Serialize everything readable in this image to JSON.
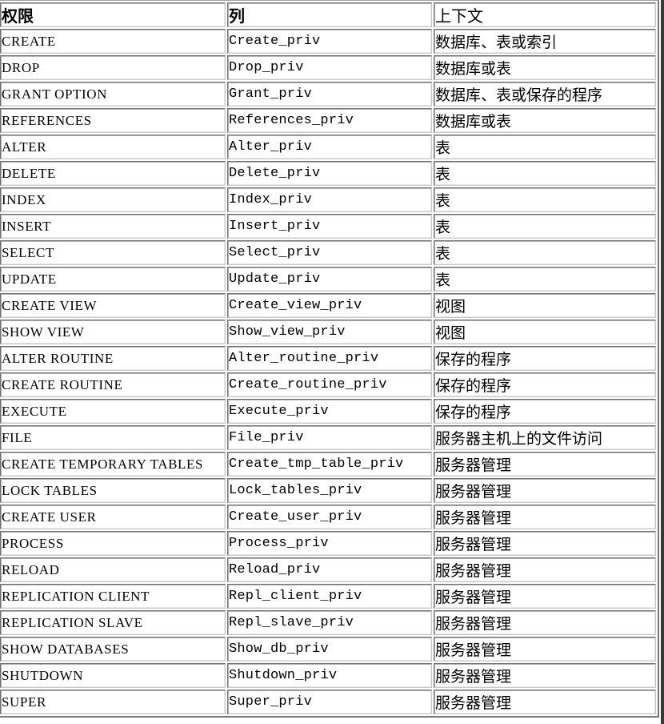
{
  "table": {
    "headers": {
      "privilege": "权限",
      "column": "列",
      "context": "上下文"
    },
    "rows": [
      {
        "privilege": "CREATE",
        "column": "Create_priv",
        "context": "数据库、表或索引"
      },
      {
        "privilege": "DROP",
        "column": "Drop_priv",
        "context": "数据库或表"
      },
      {
        "privilege": "GRANT OPTION",
        "column": "Grant_priv",
        "context": "数据库、表或保存的程序"
      },
      {
        "privilege": "REFERENCES",
        "column": "References_priv",
        "context": "数据库或表"
      },
      {
        "privilege": "ALTER",
        "column": "Alter_priv",
        "context": "表"
      },
      {
        "privilege": "DELETE",
        "column": "Delete_priv",
        "context": "表"
      },
      {
        "privilege": "INDEX",
        "column": "Index_priv",
        "context": "表"
      },
      {
        "privilege": "INSERT",
        "column": "Insert_priv",
        "context": "表"
      },
      {
        "privilege": "SELECT",
        "column": "Select_priv",
        "context": "表"
      },
      {
        "privilege": "UPDATE",
        "column": "Update_priv",
        "context": "表"
      },
      {
        "privilege": "CREATE VIEW",
        "column": "Create_view_priv",
        "context": "视图"
      },
      {
        "privilege": "SHOW VIEW",
        "column": "Show_view_priv",
        "context": "视图"
      },
      {
        "privilege": "ALTER ROUTINE",
        "column": "Alter_routine_priv",
        "context": "保存的程序"
      },
      {
        "privilege": "CREATE ROUTINE",
        "column": "Create_routine_priv",
        "context": "保存的程序"
      },
      {
        "privilege": "EXECUTE",
        "column": "Execute_priv",
        "context": "保存的程序"
      },
      {
        "privilege": "FILE",
        "column": "File_priv",
        "context": "服务器主机上的文件访问"
      },
      {
        "privilege": "CREATE TEMPORARY TABLES",
        "column": "Create_tmp_table_priv",
        "context": "服务器管理"
      },
      {
        "privilege": "LOCK TABLES",
        "column": "Lock_tables_priv",
        "context": "服务器管理"
      },
      {
        "privilege": "CREATE USER",
        "column": "Create_user_priv",
        "context": "服务器管理"
      },
      {
        "privilege": "PROCESS",
        "column": "Process_priv",
        "context": "服务器管理"
      },
      {
        "privilege": "RELOAD",
        "column": "Reload_priv",
        "context": "服务器管理"
      },
      {
        "privilege": "REPLICATION CLIENT",
        "column": "Repl_client_priv",
        "context": "服务器管理"
      },
      {
        "privilege": "REPLICATION SLAVE",
        "column": "Repl_slave_priv",
        "context": "服务器管理"
      },
      {
        "privilege": "SHOW DATABASES",
        "column": "Show_db_priv",
        "context": "服务器管理"
      },
      {
        "privilege": "SHUTDOWN",
        "column": "Shutdown_priv",
        "context": "服务器管理"
      },
      {
        "privilege": "SUPER",
        "column": "Super_priv",
        "context": "服务器管理"
      }
    ]
  }
}
